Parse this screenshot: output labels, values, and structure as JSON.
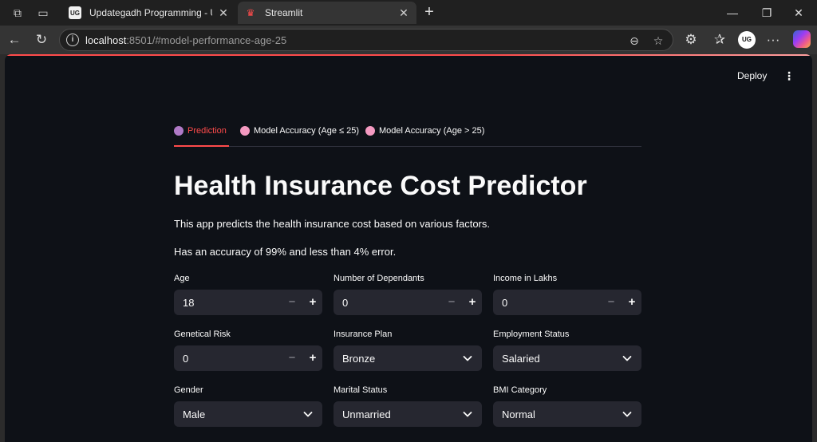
{
  "browser": {
    "tabs": [
      {
        "title": "Updategadh Programming - Upd",
        "favicon": "UG"
      },
      {
        "title": "Streamlit",
        "favicon": "♛"
      }
    ],
    "url_host": "localhost",
    "url_rest": ":8501/#model-performance-age-25",
    "avatar_text": "UG"
  },
  "header": {
    "deploy_label": "Deploy",
    "menu_glyph": "⋮"
  },
  "app_tabs": [
    {
      "label": "Prediction",
      "icon_color": "#b07ac7"
    },
    {
      "label": "Model Accuracy (Age ≤ 25)",
      "icon_color": "#f49ac1"
    },
    {
      "label": "Model Accuracy (Age > 25)",
      "icon_color": "#f49ac1"
    }
  ],
  "main": {
    "title": "Health Insurance Cost Predictor",
    "description": "This app predicts the health insurance cost based on various factors.",
    "accuracy_note": "Has an accuracy of 99% and less than 4% error."
  },
  "fields": {
    "age": {
      "label": "Age",
      "value": "18"
    },
    "dependants": {
      "label": "Number of Dependants",
      "value": "0"
    },
    "income": {
      "label": "Income in Lakhs",
      "value": "0"
    },
    "genetic_risk": {
      "label": "Genetical Risk",
      "value": "0"
    },
    "insurance_plan": {
      "label": "Insurance Plan",
      "value": "Bronze"
    },
    "employment": {
      "label": "Employment Status",
      "value": "Salaried"
    },
    "gender": {
      "label": "Gender",
      "value": "Male"
    },
    "marital": {
      "label": "Marital Status",
      "value": "Unmarried"
    },
    "bmi": {
      "label": "BMI Category",
      "value": "Normal"
    }
  },
  "stepper": {
    "minus": "−",
    "plus": "+"
  },
  "colors": {
    "accent": "#ff4b4b",
    "background": "#0e1117",
    "input_bg": "#262730"
  }
}
